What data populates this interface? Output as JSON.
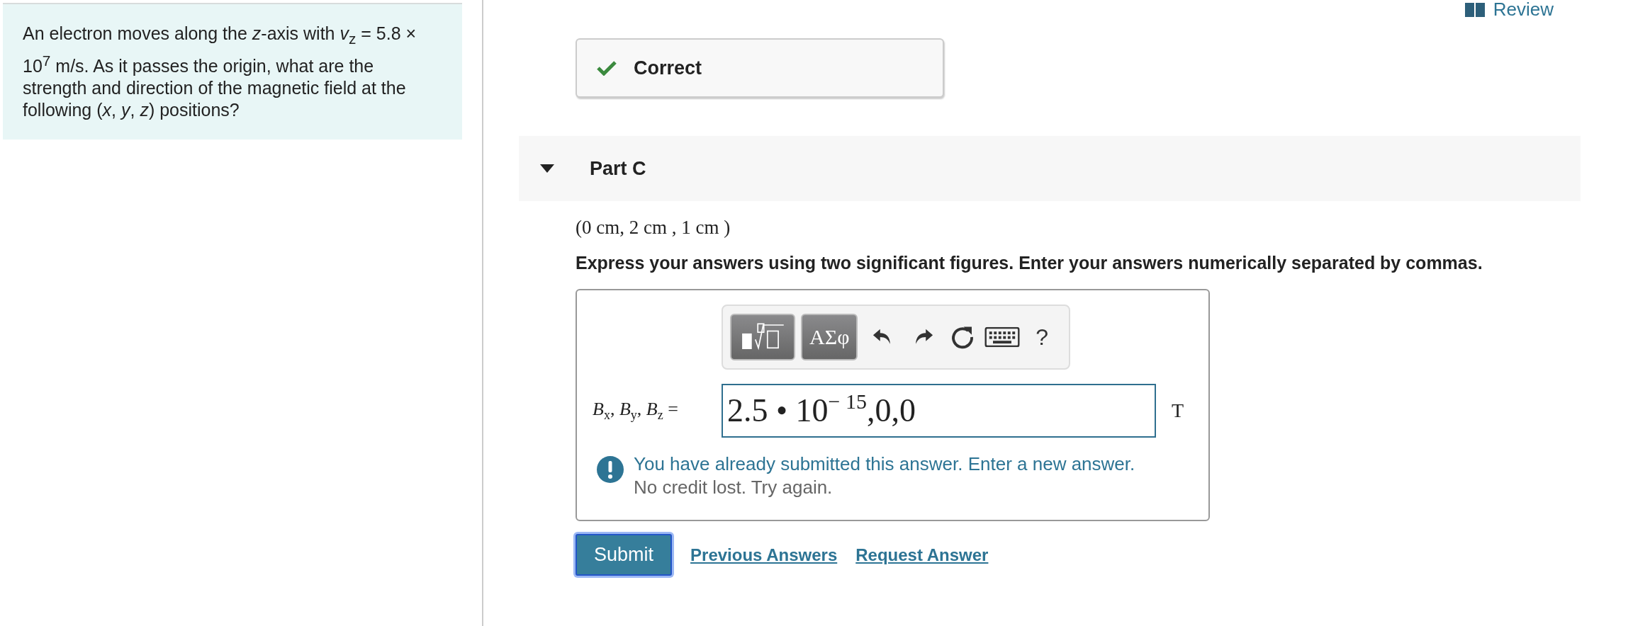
{
  "review": {
    "label": "Review"
  },
  "question": "An electron moves along the *z*-axis with *v*$_{z}$ = 5.8 × 10$^{7}$ m/s. As it passes the origin, what are the strength and direction of the magnetic field at the following (*x*, *y*, *z*) positions?",
  "feedback": {
    "kind": "correct",
    "label": "Correct"
  },
  "part": {
    "title": "Part C",
    "expanded": true,
    "coordinates": "(0 cm, 2 cm , 1 cm )",
    "instruction": "Express your answers using two significant figures. Enter your answers numerically separated by commas.",
    "toolbar": [
      {
        "kind": "templates"
      },
      {
        "kind": "symbols",
        "label": "ΑΣφ"
      },
      {
        "kind": "undo"
      },
      {
        "kind": "redo"
      },
      {
        "kind": "reset"
      },
      {
        "kind": "keyboard"
      },
      {
        "kind": "help",
        "label": "?"
      }
    ],
    "answer": {
      "label": "*B*$_{x}$, *B*$_{y}$, *B*$_{z}$ =",
      "value": "2.5 • 10$^{− 15}$,0,0",
      "unit": "T"
    },
    "message": {
      "title": "You have already submitted this answer. Enter a new answer.",
      "detail": "No credit lost. Try again."
    },
    "buttons": [
      {
        "kind": "submit",
        "label": "Submit"
      },
      {
        "kind": "link",
        "label": "Previous Answers"
      },
      {
        "kind": "link",
        "label": "Request Answer"
      }
    ]
  }
}
